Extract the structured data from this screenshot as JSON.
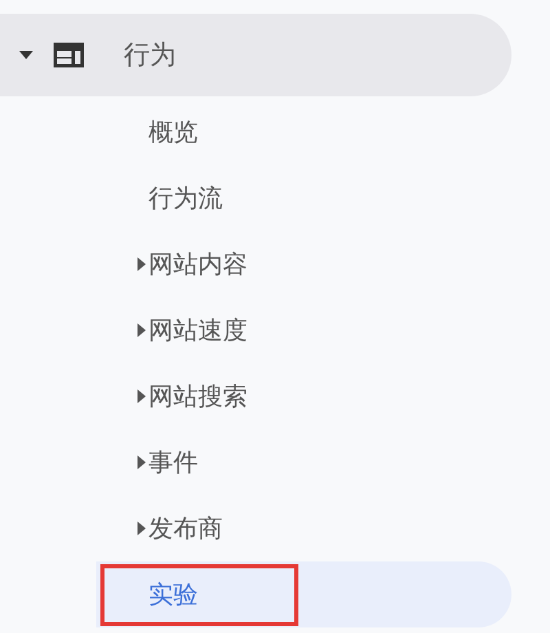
{
  "section": {
    "label": "行为",
    "expanded": true
  },
  "items": [
    {
      "label": "概览",
      "kind": "link",
      "selected": false,
      "highlighted": false
    },
    {
      "label": "行为流",
      "kind": "link",
      "selected": false,
      "highlighted": false
    },
    {
      "label": "网站内容",
      "kind": "group",
      "expanded": false,
      "selected": false,
      "highlighted": false
    },
    {
      "label": "网站速度",
      "kind": "group",
      "expanded": false,
      "selected": false,
      "highlighted": false
    },
    {
      "label": "网站搜索",
      "kind": "group",
      "expanded": false,
      "selected": false,
      "highlighted": false
    },
    {
      "label": "事件",
      "kind": "group",
      "expanded": false,
      "selected": false,
      "highlighted": false
    },
    {
      "label": "发布商",
      "kind": "group",
      "expanded": false,
      "selected": false,
      "highlighted": false
    },
    {
      "label": "实验",
      "kind": "link",
      "selected": true,
      "highlighted": true
    }
  ]
}
